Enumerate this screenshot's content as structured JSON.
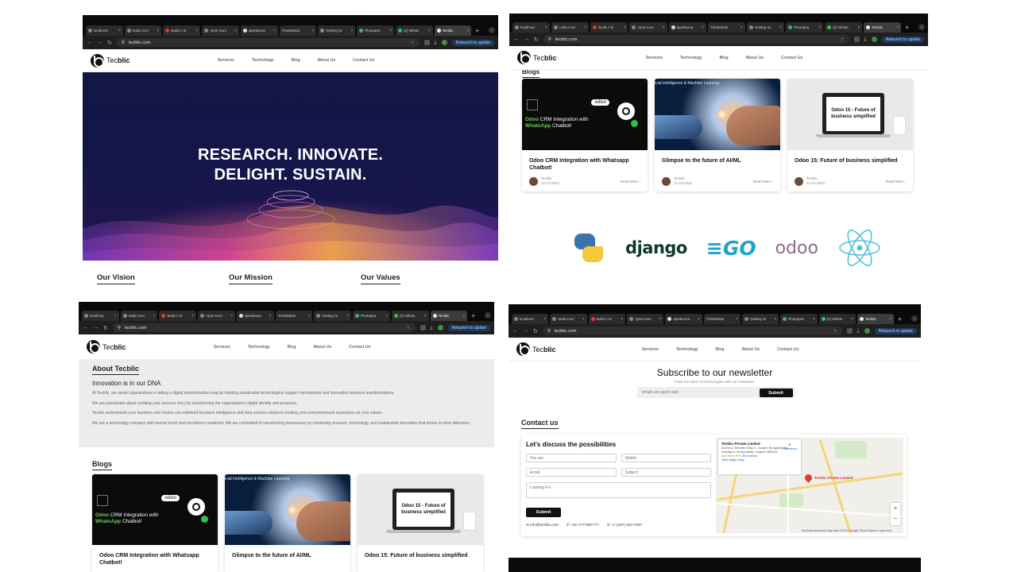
{
  "browser": {
    "tabs": [
      "localhost",
      "India Covi",
      "Build A Si",
      "Ajeet Kum",
      "ajeetkuma",
      "TheMarkdo",
      "Getting St",
      "Photopea",
      "(2) Whats",
      "Tecblic"
    ],
    "url": "tecblic.com",
    "relaunch": "Relaunch to update"
  },
  "site": {
    "brand_light": "Tec",
    "brand_bold": "blic",
    "menu": [
      "Services",
      "Technology",
      "Blog",
      "About Us",
      "Contact Us"
    ]
  },
  "hero": {
    "line1": "RESEARCH. INNOVATE.",
    "line2": "DELIGHT. SUSTAIN."
  },
  "vmv_tabs": [
    "Our Vision",
    "Our Mission",
    "Our Values"
  ],
  "blogs": {
    "heading": "Blogs",
    "read_more": "Read More",
    "cards": [
      {
        "title": "Odoo CRM Integration with Whatsapp Chatbot!",
        "author": "Tecblic",
        "date": "12-12-2022",
        "img_badge": "odoo",
        "img_line1_a": "Odoo",
        "img_line1_b": " CRM Integration with",
        "img_line2_a": "WhatsApp",
        "img_line2_b": " Chatbot!"
      },
      {
        "title": "Glimpse to the future of AI/ML",
        "author": "Tecblic",
        "date": "12-12-2022",
        "img_text": "icial Intelligence & Machine Learning"
      },
      {
        "title": "Odoo 15: Future of business simplified",
        "author": "Tecblic",
        "date": "12-12-2022",
        "img_text": "Odoo 15 - Future of business simplified"
      }
    ]
  },
  "tech_logos": [
    "python-logo",
    "django",
    "GO",
    "odoo",
    "react-logo"
  ],
  "about": {
    "heading": "About Tecblic",
    "subheading": "Innovation is in our DNA",
    "paragraphs": [
      "At Tecblic, we assist organizations in taking a digital transformation leap by building sustainable technological support mechanisms and innovative business transformations.",
      "We are passionate about creating your success story by transforming the organization's digital identity and presence.",
      "Tecblic understands your business and churns out redefined business intelligence and data science solutions treating your entrepreneurial aspirations as core values.",
      "We are a technology company with human touch and excellence mastered. We are committed to transforming businesses by combining research, technology, and sustainable innovation that drives on-time deliveries."
    ]
  },
  "newsletter": {
    "title": "Subscribe to our newsletter",
    "subtitle": "Track the latest of technologies with our newsletter.",
    "placeholder": "emails are good start",
    "button": "Submit"
  },
  "contact": {
    "heading": "Contact us",
    "form_title": "Let's discuss the possibilities",
    "fields": {
      "you_are": "You are",
      "mobile": "Mobile",
      "email": "Email",
      "subject": "Subject",
      "looking_for": "Looking For"
    },
    "submit": "Submit",
    "email": "info@tecblic.com",
    "phone1": "+91-7777907777",
    "phone2": "+1 (347) 454-7297"
  },
  "map": {
    "place": "Tecblic Private Limited",
    "address": "510/511, Shivalik Shilp 2, Judges Bungalow Rd, Vastrapur, Ahmedabad, Gujarat 380015",
    "rating": "4.4",
    "stars": "★★★★★",
    "reviews": "26 reviews",
    "larger_map": "View larger map",
    "directions": "Directions",
    "pin_label": "Tecblic Private Limited",
    "footer": "Keyboard shortcuts   Map data ©2024 Google   Terms   Report a map error"
  }
}
